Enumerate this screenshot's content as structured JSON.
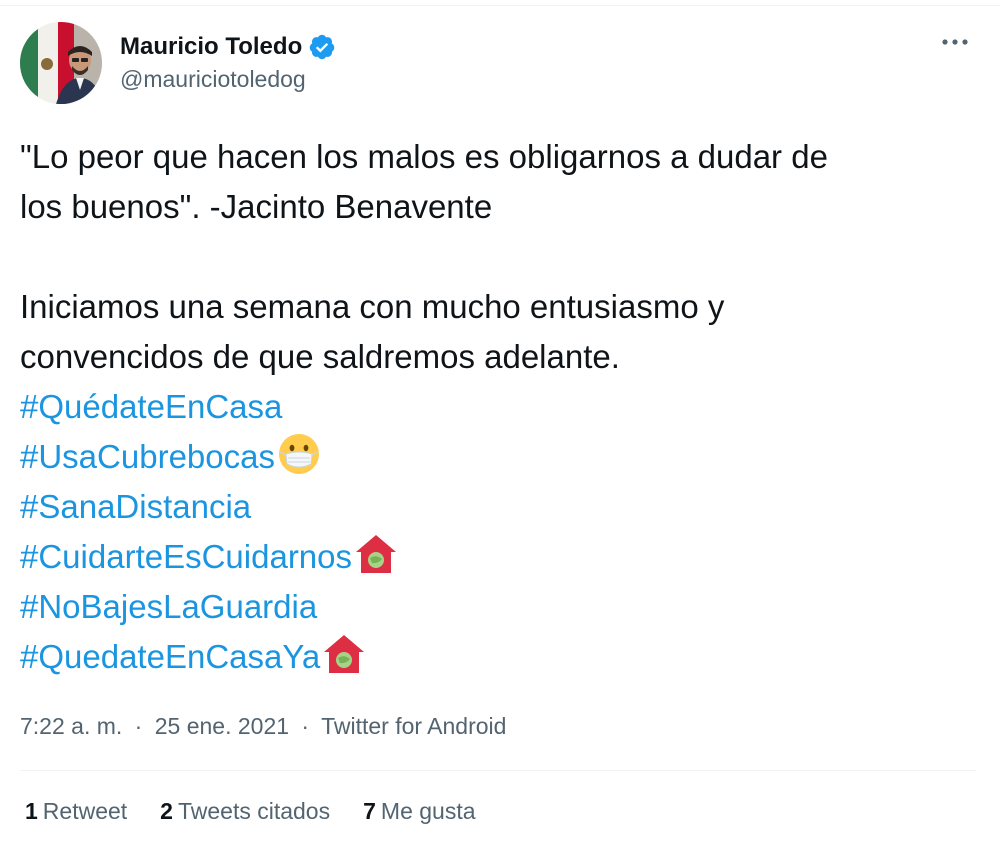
{
  "author": {
    "name": "Mauricio Toledo",
    "handle": "@mauriciotoledog",
    "verified": true,
    "avatar_icon": "profile-photo"
  },
  "tweet": {
    "quote_line1": "\"Lo peor que hacen los malos es obligarnos a dudar de",
    "quote_line2": "los buenos\". -Jacinto Benavente",
    "text_line3": "Iniciamos una semana con mucho entusiasmo y",
    "text_line4": "convencidos de que saldremos adelante.",
    "hashtags": [
      {
        "text": "#QuédateEnCasa",
        "emoji": ""
      },
      {
        "text": "#UsaCubrebocas",
        "emoji": "mask-face-emoji"
      },
      {
        "text": "#SanaDistancia",
        "emoji": ""
      },
      {
        "text": "#CuidarteEsCuidarnos",
        "emoji": "house-heart-emoji"
      },
      {
        "text": "#NoBajesLaGuardia",
        "emoji": ""
      },
      {
        "text": "#QuedateEnCasaYa",
        "emoji": "house-heart-emoji"
      }
    ]
  },
  "meta": {
    "time": "7:22 a. m.",
    "separator": "·",
    "date": "25 ene. 2021",
    "source": "Twitter for Android"
  },
  "stats": {
    "retweets_count": "1",
    "retweets_label": "Retweet",
    "quotes_count": "2",
    "quotes_label": "Tweets citados",
    "likes_count": "7",
    "likes_label": "Me gusta"
  },
  "colors": {
    "hashtag": "#1b95e0",
    "verified": "#1d9bf0",
    "secondary_text": "#536471",
    "primary_text": "#0f1419"
  }
}
